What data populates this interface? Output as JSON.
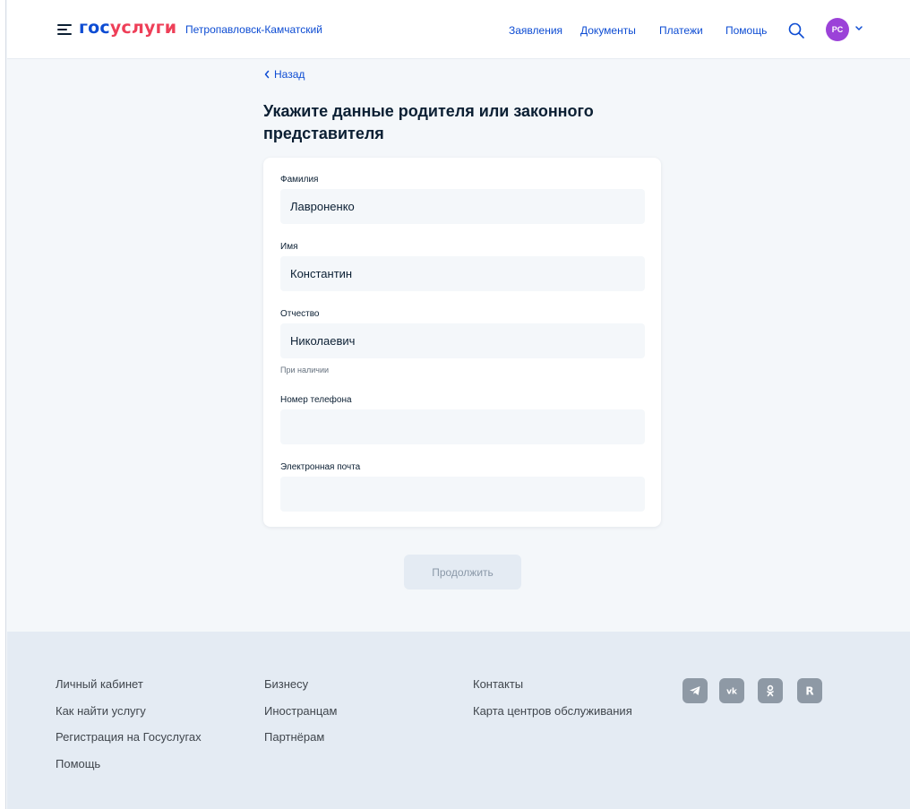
{
  "header": {
    "logo_part1": "гос",
    "logo_part2": "услуги",
    "city": "Петропавловск-Камчатский",
    "nav": [
      "Заявления",
      "Документы",
      "Платежи",
      "Помощь"
    ],
    "avatar_initials": "PC"
  },
  "content": {
    "back_label": "Назад",
    "title": "Укажите данные родителя или законного представителя"
  },
  "form": {
    "fields": [
      {
        "label": "Фамилия",
        "value": "Лавроненко",
        "hint": ""
      },
      {
        "label": "Имя",
        "value": "Константин",
        "hint": ""
      },
      {
        "label": "Отчество",
        "value": "Николаевич",
        "hint": "При наличии"
      },
      {
        "label": "Номер телефона",
        "value": "",
        "hint": ""
      },
      {
        "label": "Электронная почта",
        "value": "",
        "hint": ""
      }
    ],
    "continue_label": "Продолжить"
  },
  "footer": {
    "col1": [
      "Личный кабинет",
      "Как найти услугу",
      "Регистрация на Госуслугах",
      "Помощь"
    ],
    "col2": [
      "Бизнесу",
      "Иностранцам",
      "Партнёрам"
    ],
    "col3": [
      "Контакты",
      "Карта центров обслуживания"
    ],
    "social": [
      "telegram-icon",
      "vk-icon",
      "odnoklassniki-icon",
      "rutube-icon"
    ]
  },
  "colors": {
    "brand_blue": "#0d4cd3",
    "brand_red": "#ee3f58",
    "avatar": "#9b42d8",
    "background": "#f4f7fa",
    "footer": "#e4ebf3"
  }
}
